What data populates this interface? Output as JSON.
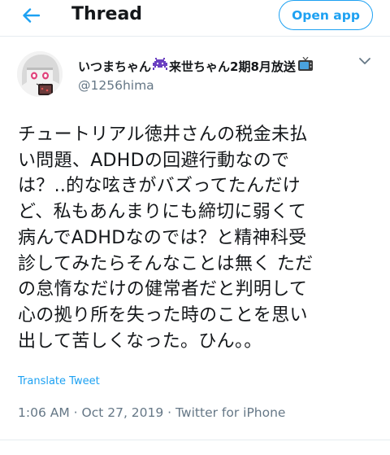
{
  "header": {
    "title": "Thread",
    "open_app_label": "Open app"
  },
  "tweet": {
    "display_name": "いつまちゃん",
    "display_name_suffix": "来世ちゃん2期8月放送",
    "handle": "@1256hima",
    "text_lines": [
      "チュートリアル徳井さんの税金未払",
      "い問題、ADHDの回避行動なので",
      "は？..的な呟きがバズってたんだけ",
      "ど、私もあんまりにも締切に弱くて",
      "病んでADHDなのでは？と精神科受",
      "診してみたらそんなことは無く ただ",
      "の怠惰なだけの健常者だと判明して",
      "心の拠り所を失った時のことを思い",
      "出して苦しくなった。ひん。。"
    ],
    "translate_label": "Translate Tweet",
    "meta": "1:06 AM · Oct 27, 2019 · Twitter for iPhone"
  },
  "icons": {
    "back": "back-arrow-icon",
    "menu": "chevron-down-icon",
    "emoji_1": "alien-monster-emoji",
    "emoji_2": "television-emoji"
  },
  "colors": {
    "accent": "#1da1f2",
    "text": "#14171a",
    "secondary": "#657786"
  }
}
